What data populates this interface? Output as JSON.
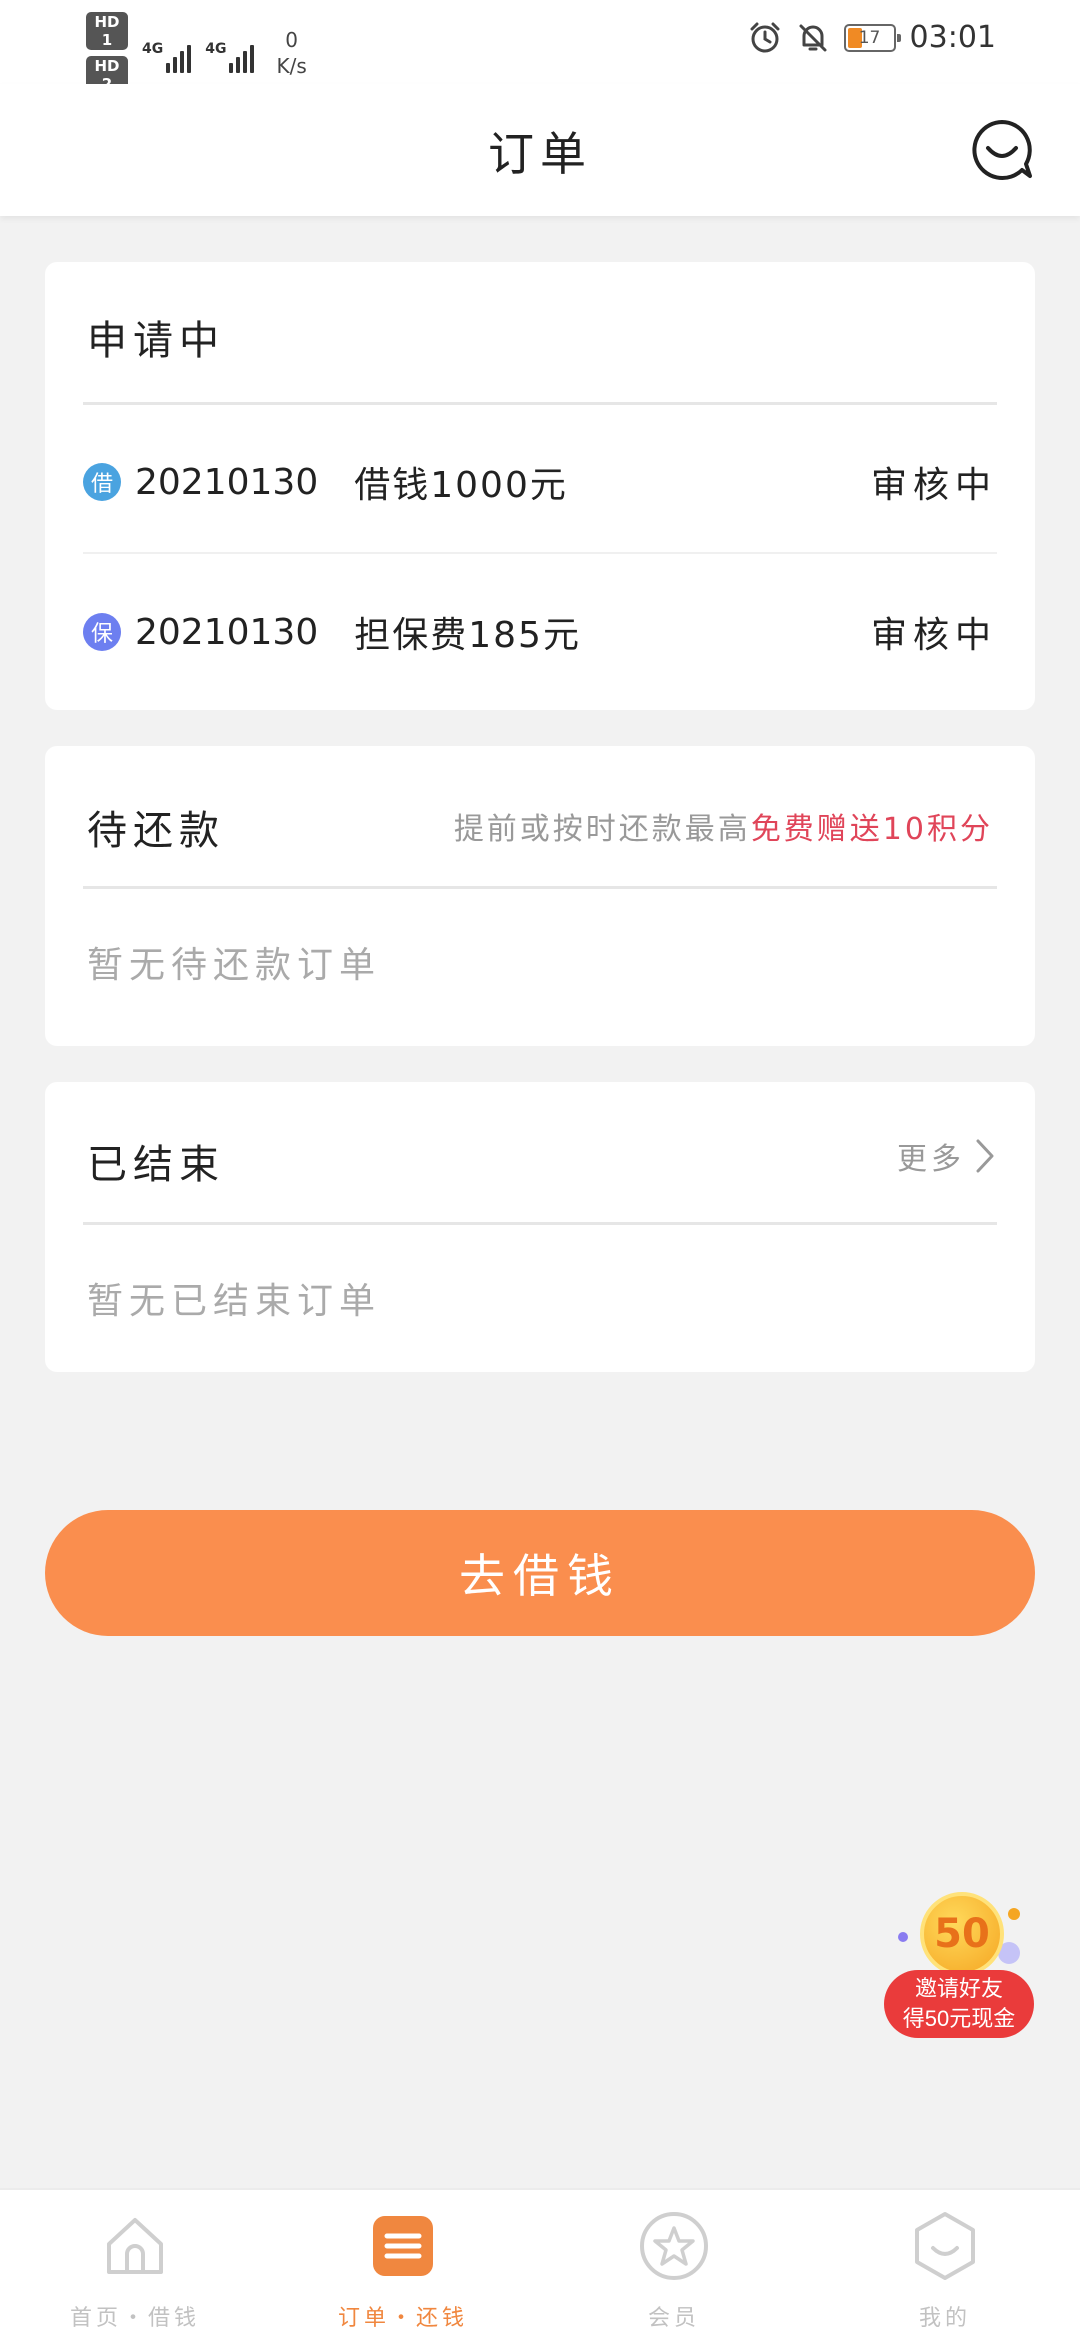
{
  "status_bar": {
    "hd1": "HD 1",
    "hd2": "HD 2",
    "sig1_label": "4G",
    "sig2_label": "4G",
    "speed_value": "0",
    "speed_unit": "K/s",
    "battery": "17",
    "time": "03:01",
    "icons": [
      "alarm-icon",
      "bell-off-icon"
    ]
  },
  "header": {
    "title": "订单"
  },
  "applying": {
    "title": "申请中",
    "rows": [
      {
        "icon_text": "借",
        "icon_color": "#4aa3e0",
        "date": "20210130",
        "desc": "借钱1000元",
        "status": "审核中"
      },
      {
        "icon_text": "保",
        "icon_color": "#6d7ff0",
        "date": "20210130",
        "desc": "担保费185元",
        "status": "审核中"
      }
    ]
  },
  "pending": {
    "title": "待还款",
    "hint_prefix": "提前或按时还款最高",
    "hint_highlight": "免费赠送10积分",
    "empty": "暂无待还款订单"
  },
  "finished": {
    "title": "已结束",
    "more": "更多",
    "empty": "暂无已结束订单"
  },
  "main_button": "去借钱",
  "invite": {
    "coin": "50",
    "line1": "邀请好友",
    "line2": "得50元现金"
  },
  "tabs": [
    {
      "label": "首页・借钱",
      "icon": "home-icon",
      "active": false
    },
    {
      "label": "订单・还钱",
      "icon": "order-list-icon",
      "active": true
    },
    {
      "label": "会员",
      "icon": "star-icon",
      "active": false
    },
    {
      "label": "我的",
      "icon": "profile-icon",
      "active": false
    }
  ],
  "colors": {
    "accent": "#fa8e4e",
    "tab_active": "#f0873f",
    "highlight": "#e04559",
    "invite_red": "#ea3b3b"
  }
}
